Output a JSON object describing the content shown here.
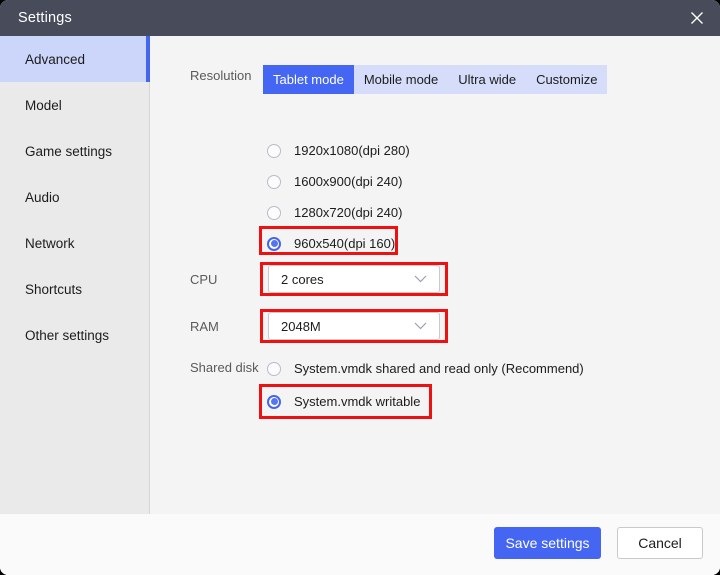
{
  "window": {
    "title": "Settings",
    "close_icon": "close-icon",
    "accent_color": "#4466f2",
    "titlebar_color": "#474b5a",
    "highlight_color": "#ee1111"
  },
  "sidebar": {
    "items": [
      {
        "label": "Advanced",
        "active": true
      },
      {
        "label": "Model",
        "active": false
      },
      {
        "label": "Game settings",
        "active": false
      },
      {
        "label": "Audio",
        "active": false
      },
      {
        "label": "Network",
        "active": false
      },
      {
        "label": "Shortcuts",
        "active": false
      },
      {
        "label": "Other settings",
        "active": false
      }
    ]
  },
  "main": {
    "resolution": {
      "label": "Resolution",
      "tabs": [
        {
          "label": "Tablet mode",
          "active": true
        },
        {
          "label": "Mobile mode",
          "active": false
        },
        {
          "label": "Ultra wide",
          "active": false
        },
        {
          "label": "Customize",
          "active": false
        }
      ],
      "options": [
        {
          "label": "1920x1080(dpi 280)",
          "selected": false,
          "highlighted": false
        },
        {
          "label": "1600x900(dpi 240)",
          "selected": false,
          "highlighted": false
        },
        {
          "label": "1280x720(dpi 240)",
          "selected": false,
          "highlighted": false
        },
        {
          "label": "960x540(dpi 160)",
          "selected": true,
          "highlighted": true
        }
      ]
    },
    "cpu": {
      "label": "CPU",
      "value": "2 cores",
      "chevron_icon": "chevron-down-icon",
      "highlighted": true
    },
    "ram": {
      "label": "RAM",
      "value": "2048M",
      "chevron_icon": "chevron-down-icon",
      "highlighted": true
    },
    "shared_disk": {
      "label": "Shared disk",
      "options": [
        {
          "label": "System.vmdk shared and read only (Recommend)",
          "selected": false,
          "highlighted": false
        },
        {
          "label": "System.vmdk writable",
          "selected": true,
          "highlighted": true
        }
      ]
    }
  },
  "footer": {
    "save_label": "Save settings",
    "cancel_label": "Cancel"
  }
}
